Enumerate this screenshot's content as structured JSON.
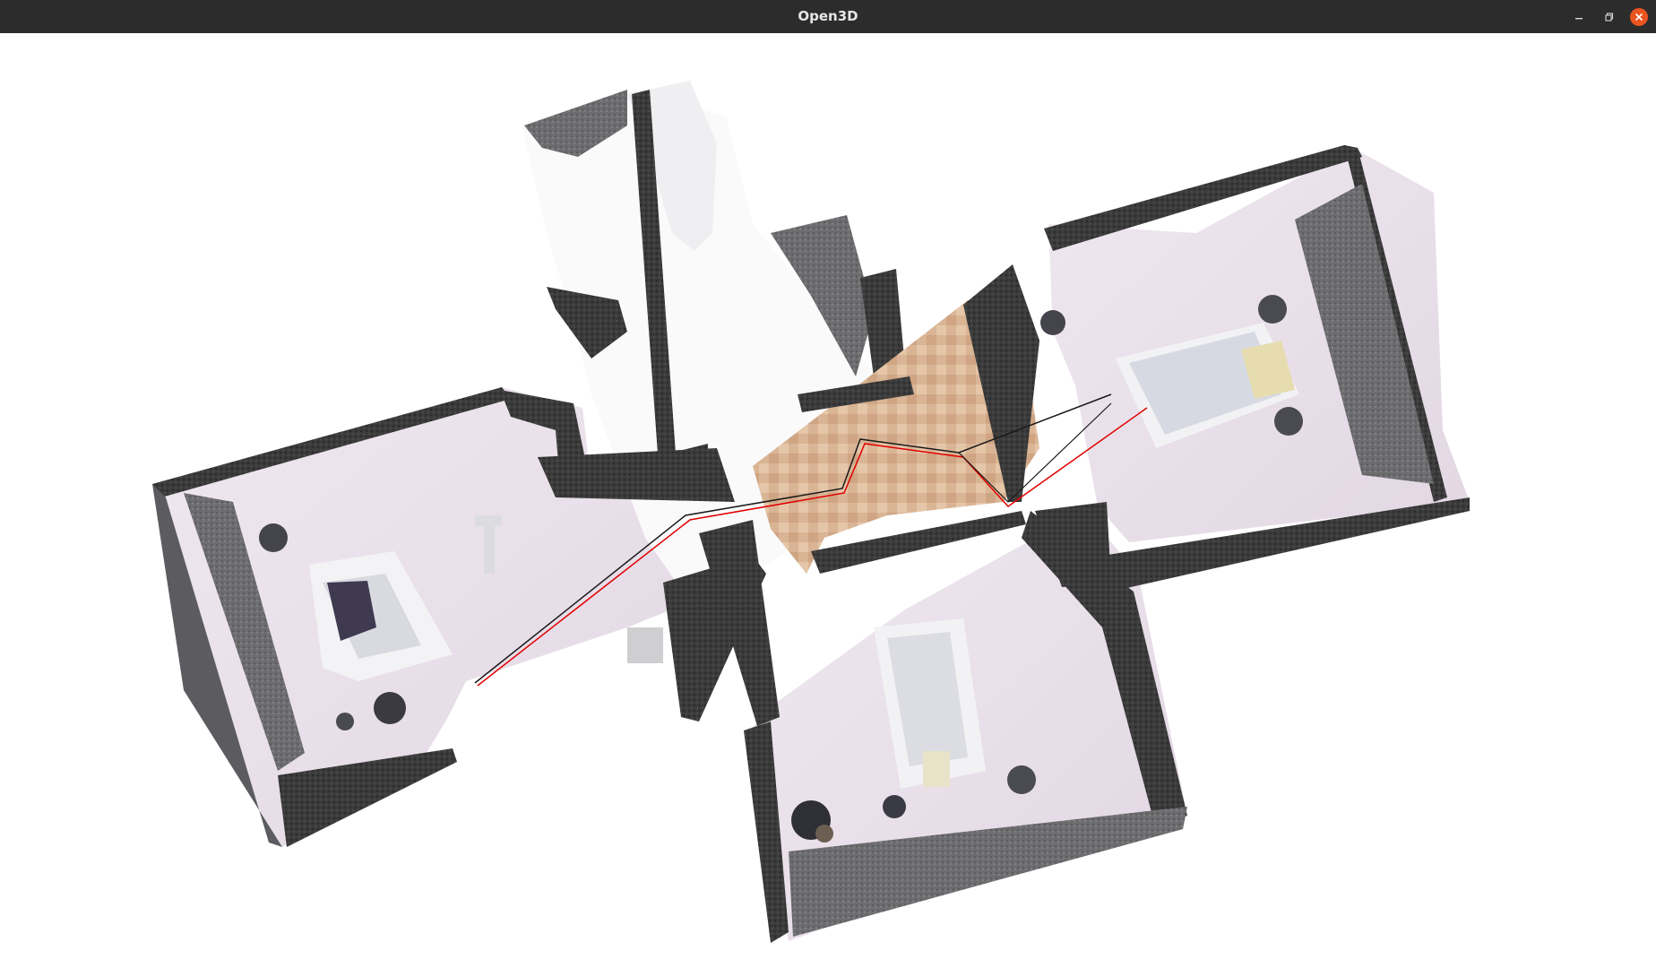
{
  "window": {
    "title": "Open3D",
    "controls": {
      "minimize_icon": "minimize-icon",
      "restore_icon": "restore-icon",
      "close_icon": "close-icon"
    }
  },
  "viewer": {
    "background_color": "#ffffff",
    "trajectory_colors": {
      "path_a": "#1a1a1a",
      "path_b": "#e00000"
    }
  }
}
